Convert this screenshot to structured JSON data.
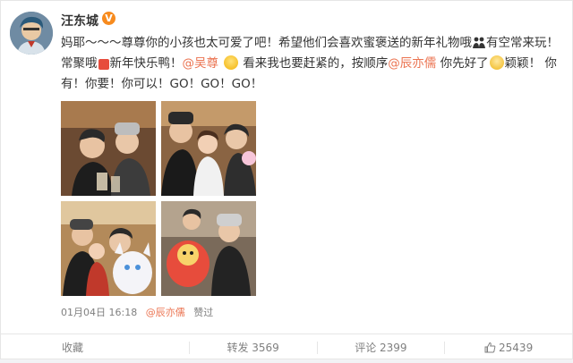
{
  "user": {
    "name": "汪东城",
    "verified_badge": "V"
  },
  "post": {
    "text_1": "妈耶～～～尊尊你的小孩也太可爱了吧！希望他们会喜欢蜜褒送的新年礼物哦",
    "text_2": "有空常来玩！常聚哦",
    "text_3": "新年快乐鸭！",
    "mention_1": "@吴尊",
    "text_4": " 看来我也要赶紧的，按顺序",
    "mention_2": "@辰亦儒",
    "text_5": " 你先好了",
    "text_6": "颖颖！ 你有！你要！你可以！GO！GO！GO！"
  },
  "photos": [
    {
      "alt": "photo-1"
    },
    {
      "alt": "photo-2"
    },
    {
      "alt": "photo-3"
    },
    {
      "alt": "photo-4"
    }
  ],
  "meta": {
    "time": "01月04日 16:18",
    "via_user": "@辰亦儒",
    "liked_label": "赞过"
  },
  "actions": {
    "favorite": "收藏",
    "repost": "转发 3569",
    "comment": "评论 2399",
    "like": "25439"
  },
  "colors": {
    "mention": "#eb7350",
    "meta_gray": "#808080",
    "verified_orange": "#f78b1e"
  },
  "icons": [
    "verified-icon",
    "cute-face-emoji",
    "people-emoji",
    "heart-emoji",
    "smile-emoji",
    "thumbs-up-icon"
  ]
}
